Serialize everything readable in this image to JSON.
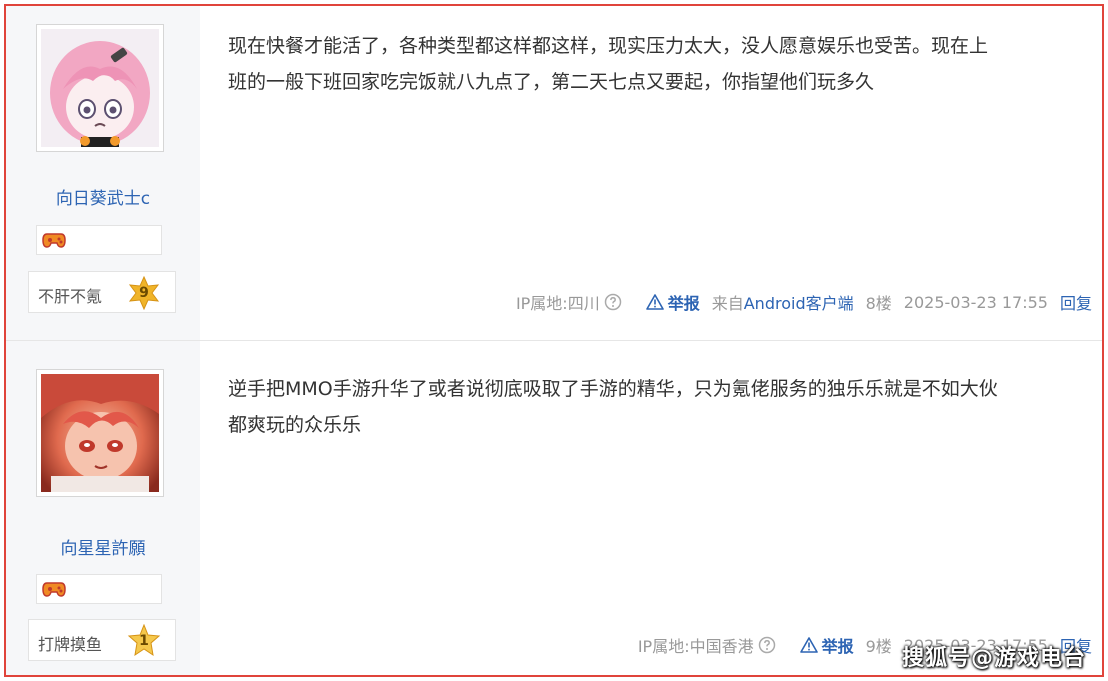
{
  "posts": [
    {
      "username": "向日葵武士c",
      "level_title": "不肝不氪",
      "level_number": "9",
      "content_lines": [
        "现在快餐才能活了，各种类型都这样都这样，现实压力太大，没人愿意娱乐也受苦。现在上",
        "班的一般下班回家吃完饭就八九点了，第二天七点又要起，你指望他们玩多久"
      ],
      "ip": "IP属地:四川",
      "report_label": "举报",
      "source_prefix": "来自",
      "source_link": "Android客户端",
      "floor": "8楼",
      "time": "2025-03-23 17:55",
      "reply_label": "回复",
      "accent_color": "#2d64b3"
    },
    {
      "username": "向星星許願",
      "level_title": "打牌摸鱼",
      "level_number": "1",
      "content_lines": [
        "逆手把MMO手游升华了或者说彻底吸取了手游的精华，只为氪佬服务的独乐乐就是不如大伙",
        "都爽玩的众乐乐"
      ],
      "ip": "IP属地:中国香港",
      "report_label": "举报",
      "floor": "9楼",
      "time": "2025-03-23 17:55",
      "reply_label": "回复",
      "accent_color": "#2d64b3"
    }
  ],
  "watermark": "搜狐号@游戏电台",
  "icons": {
    "help": "question-circle-icon",
    "report": "warning-triangle-icon",
    "badge": "gamepad-icon",
    "level": "star-icon"
  },
  "colors": {
    "frame_border": "#e0443b",
    "sidebar_bg": "#f6f7f9",
    "link": "#2d64b3",
    "meta_gray": "#999999",
    "star_gold": "#f0b429"
  }
}
